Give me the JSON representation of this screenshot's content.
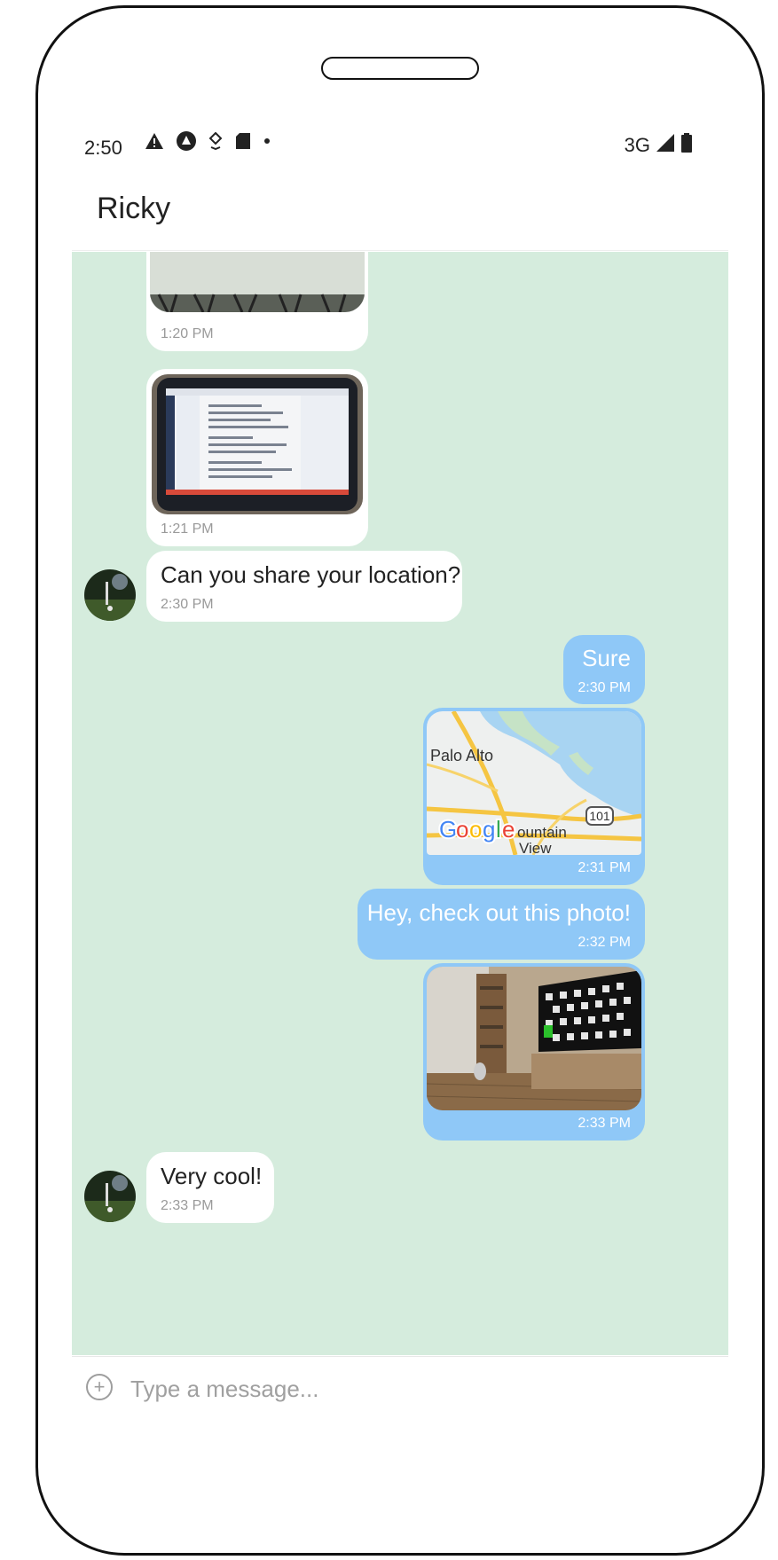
{
  "status_bar": {
    "time": "2:50",
    "network": "3G",
    "icons": [
      "warning-icon",
      "app-notification-icon",
      "download-icon",
      "sd-card-icon",
      "dot-icon",
      "signal-icon",
      "battery-icon"
    ]
  },
  "header": {
    "title": "Ricky"
  },
  "messages": [
    {
      "direction": "incoming",
      "type": "image",
      "image": "forest-photo-partial",
      "time": "1:20 PM"
    },
    {
      "direction": "incoming",
      "type": "image",
      "image": "laptop-screen-photo",
      "time": "1:21 PM"
    },
    {
      "direction": "incoming",
      "type": "text",
      "text": "Can you share your location?",
      "time": "2:30 PM",
      "avatar": true
    },
    {
      "direction": "outgoing",
      "type": "text",
      "text": "Sure",
      "time": "2:30 PM"
    },
    {
      "direction": "outgoing",
      "type": "map",
      "map_labels": [
        "Palo Alto",
        "Google",
        "ountain",
        "View",
        "101"
      ],
      "time": "2:31 PM"
    },
    {
      "direction": "outgoing",
      "type": "text",
      "text": "Hey, check out this photo!",
      "time": "2:32 PM"
    },
    {
      "direction": "outgoing",
      "type": "image",
      "image": "living-room-tv-checkerboard",
      "time": "2:33 PM"
    },
    {
      "direction": "incoming",
      "type": "text",
      "text": "Very cool!",
      "time": "2:33 PM",
      "avatar": true
    }
  ],
  "composer": {
    "placeholder": "Type a message...",
    "value": ""
  },
  "nav": {
    "items": [
      "home-icon",
      "chat-icon"
    ],
    "active": "chat-icon"
  },
  "colors": {
    "chat_background": "#d5ecdd",
    "outgoing_bubble": "#8fc8f7",
    "incoming_bubble": "#ffffff",
    "active_nav": "#1a73e8",
    "inactive_nav": "#8a8a8a"
  }
}
